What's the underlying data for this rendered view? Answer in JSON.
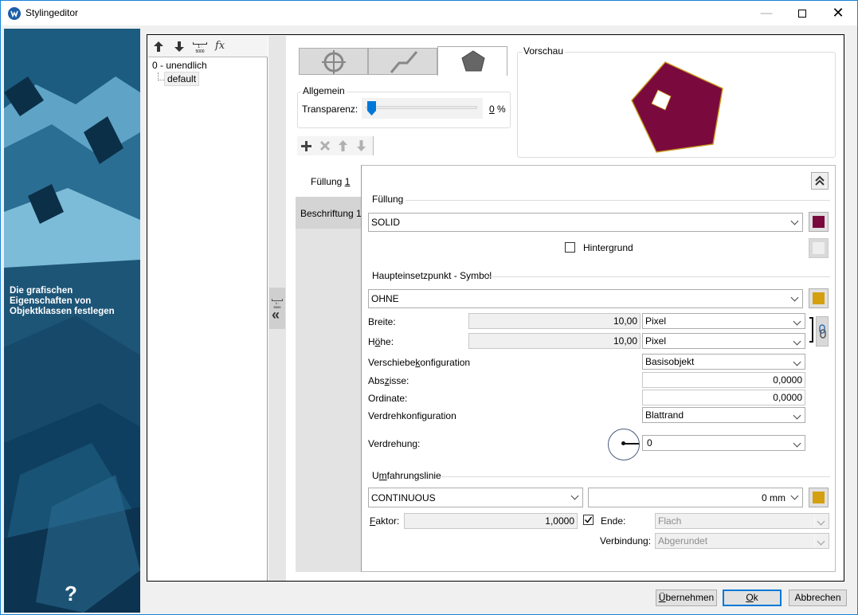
{
  "window": {
    "title": "Stylingeditor",
    "icon": "app-logo-icon"
  },
  "sidebar": {
    "description": "Die grafischen Eigenschaften von Objektklassen festlegen",
    "help_glyph": "?"
  },
  "tree": {
    "toolbar": {
      "scale_label": "1 : 5000",
      "fx_label": "fx"
    },
    "root_label": "0 - unendlich",
    "child_label": "default"
  },
  "collapse": {
    "scale_label": "1 : 5000",
    "glyph": "«"
  },
  "geometry_tabs": [
    "point",
    "line",
    "polygon"
  ],
  "allgemein": {
    "title": "Allgemein",
    "transparency_label": "Transparenz:",
    "transparency_value": "0",
    "transparency_unit": "%",
    "transparency_fraction": 0.0
  },
  "vorschau": {
    "title": "Vorschau",
    "fill_color": "#7a0a3e",
    "stroke_color": "#c99a1e"
  },
  "layer_toolbar": [
    "add-icon",
    "delete-icon",
    "move-up-icon",
    "move-down-icon"
  ],
  "side_tabs": [
    "Füllung 1",
    "Beschriftung 1"
  ],
  "fuellung": {
    "section_title": "Füllung",
    "type": "SOLID",
    "color": "#7a0a3e",
    "background_label": "Hintergrund",
    "background_checked": false
  },
  "symbol": {
    "section_title": "Haupteinsetzpunkt - Symbol",
    "type": "OHNE",
    "color": "#d4a010",
    "breite_label": "Breite:",
    "breite_value": "10,00",
    "breite_unit": "Pixel",
    "hoehe_label": "Höhe:",
    "hoehe_value": "10,00",
    "hoehe_unit": "Pixel",
    "verschiebe_label": "Verschiebekonfiguration",
    "verschiebe_value": "Basisobjekt",
    "abszisse_label": "Abszisse:",
    "abszisse_value": "0,0000",
    "ordinate_label": "Ordinate:",
    "ordinate_value": "0,0000",
    "verdreh_label": "Verdrehkonfiguration",
    "verdreh_value": "Blattrand",
    "verdrehung_label": "Verdrehung:",
    "verdrehung_value": "0"
  },
  "umfahrung": {
    "section_title": "Umfahrungslinie",
    "line_type": "CONTINUOUS",
    "width_value": "0 mm",
    "color": "#d4a010",
    "faktor_label": "Faktor:",
    "faktor_value": "1,0000",
    "ende_checked": true,
    "ende_label": "Ende:",
    "ende_value": "Flach",
    "verbindung_label": "Verbindung:",
    "verbindung_value": "Abgerundet"
  },
  "buttons": {
    "apply": "Übernehmen",
    "ok": "Ok",
    "cancel": "Abbrechen"
  }
}
